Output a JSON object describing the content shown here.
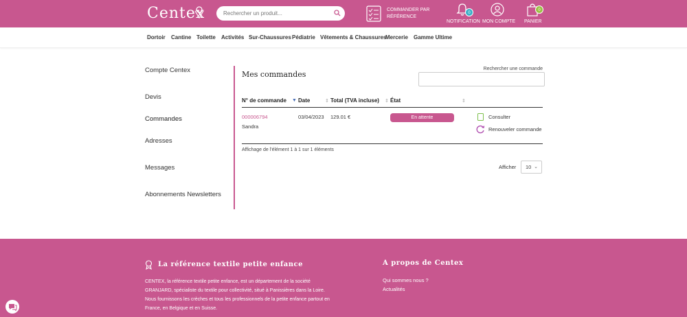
{
  "header": {
    "logo_text": "Centex",
    "search_placeholder": "Rechercher un produit...",
    "order_by_ref": {
      "line1": "COMMANDER PAR",
      "line2": "RÉFÉRENCE"
    },
    "notification": {
      "label": "NOTIFICATION",
      "count": "0"
    },
    "account": {
      "label": "MON COMPTE"
    },
    "cart": {
      "label": "PANIER",
      "count": "0"
    },
    "brand_color": "#c8578f"
  },
  "nav": [
    "Dortoir",
    "Cantine",
    "Toilette",
    "Activités",
    "Sur-Chaussures",
    "Pédiatrie",
    "Vêtements & Chaussures",
    "Mercerie",
    "Gamme Ultime"
  ],
  "sidebar": [
    "Compte Centex",
    "Devis",
    "Commandes",
    "Adresses",
    "Messages",
    "Abonnements Newsletters"
  ],
  "main": {
    "title": "Mes commandes",
    "search_label": "Rechercher une commande",
    "columns": [
      "N° de commande",
      "Date",
      "Total (TVA incluse)",
      "État"
    ],
    "rows": [
      {
        "order_number": "000006794",
        "customer": "Sandra",
        "date": "03/04/2023",
        "total": "129.01 €",
        "status": "En attente",
        "actions": [
          "Consulter",
          "Renouveler commande"
        ]
      }
    ],
    "info": "Affichage de l'élément 1 à 1 sur 1 éléments",
    "length_label": "Afficher",
    "length_value": "10"
  },
  "footer": {
    "left_title": "La référence textile petite enfance",
    "left_text": "CENTEX, la référence textile petite enfance, est un département de la société GRANJARD, spécialiste du textile pour collectivité, situé à Panissières dans la Loire. Nous fournissons les crèches et tous les professionnels de la petite enfance partout en France, en Belgique et en Suisse.",
    "right_title": "A propos de Centex",
    "links": [
      "Qui sommes nous ?",
      "Actualités"
    ]
  }
}
